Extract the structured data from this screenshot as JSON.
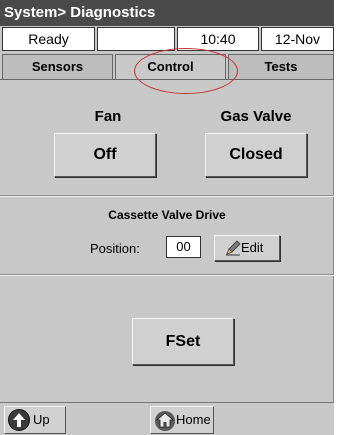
{
  "title": "System> Diagnostics",
  "status": {
    "state": "Ready",
    "blank": "",
    "time": "10:40",
    "date": "12-Nov"
  },
  "tabs": [
    {
      "label": "Sensors"
    },
    {
      "label": "Control"
    },
    {
      "label": "Tests"
    }
  ],
  "active_tab": "Control",
  "annotation_color": "#c83232",
  "fan": {
    "label": "Fan",
    "button": "Off"
  },
  "gas_valve": {
    "label": "Gas Valve",
    "button": "Closed"
  },
  "cassette": {
    "title": "Cassette Valve Drive",
    "position_label": "Position:",
    "position_value": "00",
    "edit_label": "Edit",
    "edit_icon": "pencil-icon"
  },
  "fset_label": "FSet",
  "bottom_nav": {
    "up_label": "Up",
    "up_icon": "up-arrow-icon",
    "home_label": "Home",
    "home_icon": "home-icon"
  }
}
